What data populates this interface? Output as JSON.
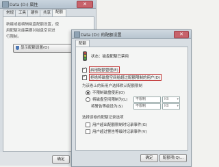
{
  "back_window": {
    "title": "Data (D:) 属性",
    "close_label": "✕",
    "tabs": [
      "常规",
      "工具",
      "硬件",
      "共享",
      "配额"
    ],
    "desc_lines": [
      "新建或者编辑磁盘配额设置，使",
      "用配额功能需要对磁盘空间进",
      "行限制。"
    ],
    "quota_button_label": "显示配额设置(O)",
    "ok_label": "确定"
  },
  "front_window": {
    "title": "Data (D:) 的配额设置",
    "close_label": "✕",
    "tab": "配额",
    "status": "状态：磁盘配额已禁用",
    "enable_quota": "启用配额管理(E)",
    "deny_space": "拒绝将磁盘空间给超过配额限制的用户(D)",
    "section_limit": "为该卷上的新用户选择默认配额限制",
    "no_limit": "不限制磁盘使用(O)",
    "limit_space": "将磁盘空间限制为(L)",
    "limit_value": "不限制",
    "warning_level": "将警告等级设为(S)",
    "warning_value": "不限制",
    "unit_label": "KB",
    "section_log": "选择该卷的配额记录选项",
    "log_exceed_limit": "用户超出配额限制时记录事件(G)",
    "log_exceed_warning": "用户超过警告等级时记录事件(V)",
    "ok_label": "确定",
    "entries_label": "配额项(Q)..."
  }
}
